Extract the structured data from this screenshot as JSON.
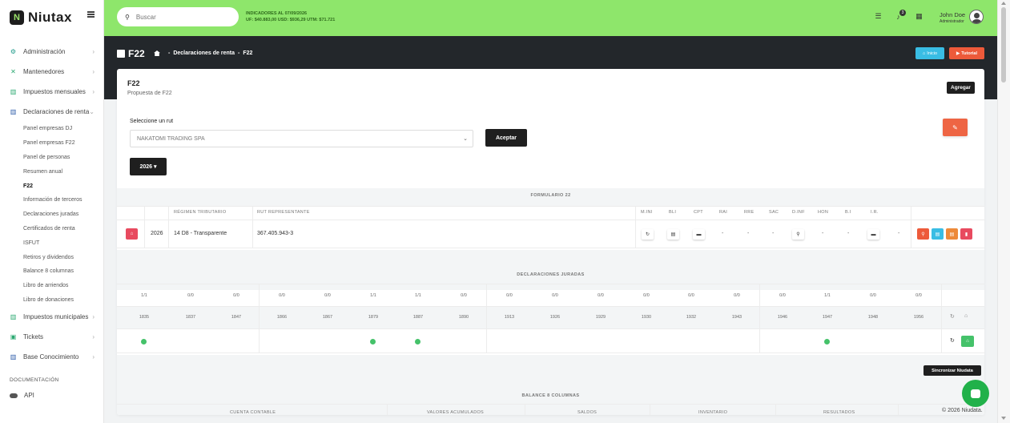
{
  "app": {
    "name": "Niutax",
    "logo_mark": "N"
  },
  "sidebar": {
    "items": [
      {
        "label": "Administración",
        "icon": "gear-icon",
        "glyph": "⚙",
        "color": "#1e9a8a"
      },
      {
        "label": "Mantenedores",
        "icon": "tools-icon",
        "glyph": "✕",
        "color": "#2aa870"
      },
      {
        "label": "Impuestos mensuales",
        "icon": "buildings-icon",
        "glyph": "▥",
        "color": "#2aa870"
      },
      {
        "label": "Declaraciones de renta",
        "icon": "institution-icon",
        "glyph": "▥",
        "color": "#2a5aa8"
      }
    ],
    "sub_items": [
      "Panel empresas DJ",
      "Panel empresas F22",
      "Panel de personas",
      "Resumen anual",
      "F22",
      "Información de terceros",
      "Declaraciones juradas",
      "Certificados de renta",
      "ISFUT",
      "Retiros y dividendos",
      "Balance 8 columnas",
      "Libro de arriendos",
      "Libro de donaciones"
    ],
    "items_after": [
      {
        "label": "Impuestos municipales",
        "icon": "buildings-icon",
        "glyph": "▥",
        "color": "#2aa870"
      },
      {
        "label": "Tickets",
        "icon": "ticket-icon",
        "glyph": "▣",
        "color": "#2aa870"
      },
      {
        "label": "Base Conocimiento",
        "icon": "institution-icon",
        "glyph": "▥",
        "color": "#2a5aa8"
      }
    ],
    "doc_heading": "DOCUMENTACIÓN",
    "api_label": "API"
  },
  "header": {
    "search_placeholder": "Buscar",
    "indicators_title": "INDICADORES AL 07/09/2026",
    "indicators_values": "UF: $40.883,00   USD: $936,29   UTM: $71.721",
    "notifications_count": "3",
    "user_name": "John Doe",
    "user_role": "Administrador"
  },
  "band": {
    "page_title": "F22",
    "crumb_1": "Declaraciones de renta",
    "crumb_2": "F22",
    "inicio_label": "Inicio",
    "tutorial_label": "Tutorial"
  },
  "card": {
    "title": "F22",
    "subtitle": "Propuesta de F22",
    "agregar_label": "Agregar",
    "rut_label": "Seleccione un rut",
    "rut_value": "NAKATOMI TRADING SPA",
    "aceptar_label": "Aceptar",
    "year_label": "2026 ▾"
  },
  "formulario": {
    "title": "FORMULARIO 22",
    "headers": {
      "regimen": "RÉGIMEN TRIBUTARIO",
      "rut_rep": "RUT REPRESENTANTE",
      "cols": [
        "M.INI",
        "BLI",
        "CPT",
        "RAI",
        "RRE",
        "SAC",
        "D.INF",
        "HON",
        "B.I",
        "I.R."
      ]
    },
    "row": {
      "year": "2026",
      "regimen": "14 D8 - Transparente",
      "rut": "367.405.943-3",
      "dash": "-"
    }
  },
  "dj": {
    "title": "DECLARACIONES JURADAS",
    "ratios": [
      "1/1",
      "0/0",
      "0/0",
      "0/0",
      "0/0",
      "1/1",
      "1/1",
      "0/0",
      "0/0",
      "0/0",
      "0/0",
      "0/0",
      "0/0",
      "0/0",
      "0/0",
      "1/1",
      "0/0",
      "0/0"
    ],
    "codes": [
      "1835",
      "1837",
      "1847",
      "1866",
      "1867",
      "1879",
      "1887",
      "1890",
      "1913",
      "1926",
      "1929",
      "1930",
      "1932",
      "1943",
      "1946",
      "1947",
      "1948",
      "1956"
    ],
    "dots": [
      true,
      false,
      false,
      false,
      false,
      true,
      true,
      false,
      false,
      false,
      false,
      false,
      false,
      false,
      false,
      true,
      false,
      false
    ]
  },
  "balance": {
    "title": "BALANCE 8 COLUMNAS",
    "headers": [
      "CUENTA CONTABLE",
      "VALORES ACUMULADOS",
      "SALDOS",
      "INVENTARIO",
      "RESULTADOS"
    ]
  },
  "tooltip": "Sincronizar Niudata",
  "footer": {
    "copyright": "© 2026 Niudata."
  },
  "colors": {
    "accent_green": "#8ee66b",
    "dark": "#23272b",
    "danger": "#e84a5f",
    "info": "#39bde4",
    "warning": "#ed8a3a",
    "success": "#45c26a"
  }
}
